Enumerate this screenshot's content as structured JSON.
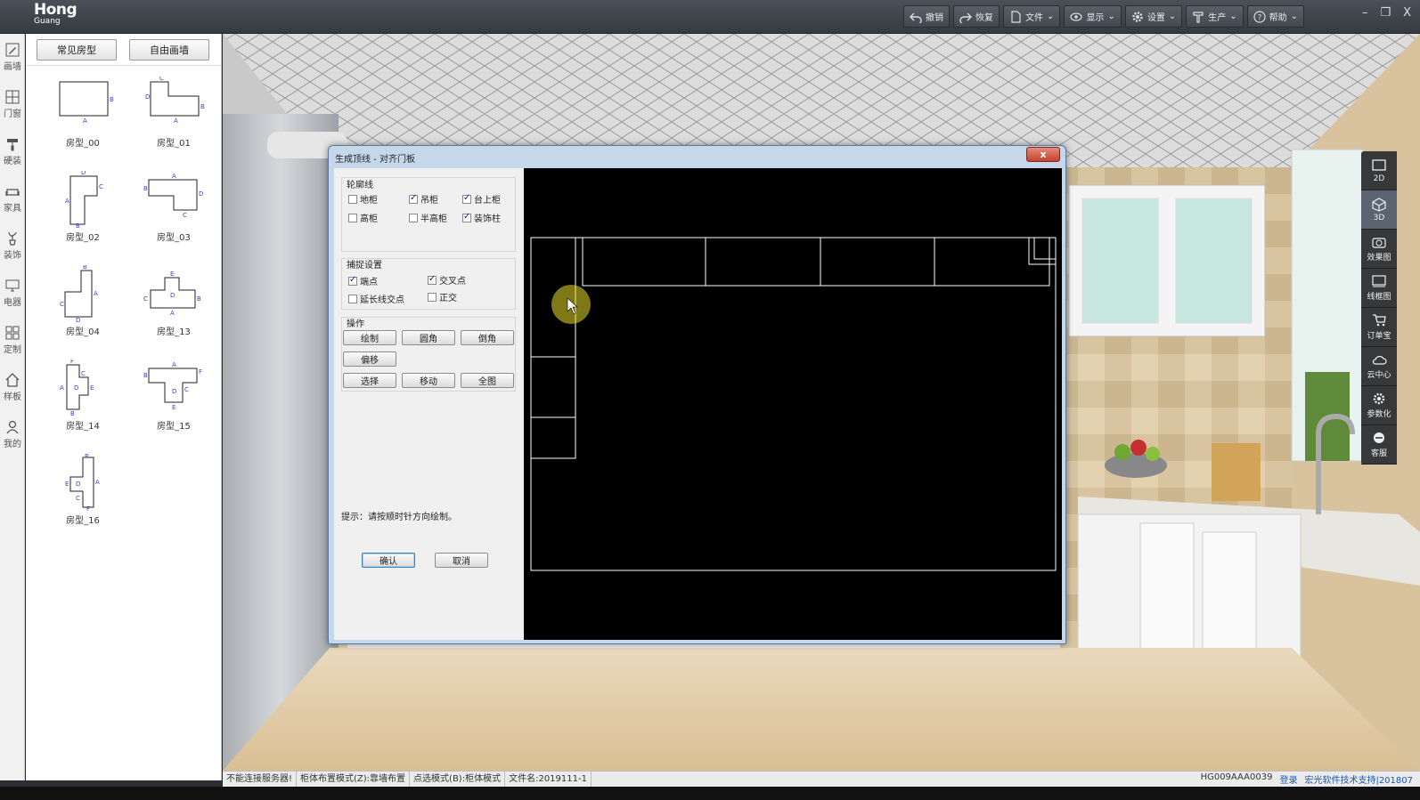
{
  "app": {
    "logo_main": "Hong",
    "logo_sub": "Guang"
  },
  "toolbar": [
    {
      "label": "撤销",
      "icon": "undo-icon"
    },
    {
      "label": "恢复",
      "icon": "redo-icon"
    },
    {
      "label": "文件",
      "icon": "file-icon"
    },
    {
      "label": "显示",
      "icon": "eye-icon"
    },
    {
      "label": "设置",
      "icon": "gear-icon"
    },
    {
      "label": "生产",
      "icon": "tool-icon"
    },
    {
      "label": "帮助",
      "icon": "help-icon"
    }
  ],
  "window_controls": {
    "minimize": "–",
    "restore": "❐",
    "close": "X"
  },
  "rail": [
    {
      "label": "画墙",
      "icon": "pencil-icon"
    },
    {
      "label": "门窗",
      "icon": "window-icon"
    },
    {
      "label": "硬装",
      "icon": "roller-icon"
    },
    {
      "label": "家具",
      "icon": "sofa-icon"
    },
    {
      "label": "装饰",
      "icon": "plant-icon"
    },
    {
      "label": "电器",
      "icon": "monitor-icon"
    },
    {
      "label": "定制",
      "icon": "grid-icon"
    },
    {
      "label": "样板",
      "icon": "home-icon"
    },
    {
      "label": "我的",
      "icon": "user-icon"
    }
  ],
  "room_panel": {
    "tabs": [
      "常见房型",
      "自由画墙"
    ],
    "rooms": [
      {
        "name": "房型_00",
        "letters": [
          "A",
          "B"
        ]
      },
      {
        "name": "房型_01",
        "letters": [
          "A",
          "B",
          "C",
          "D"
        ]
      },
      {
        "name": "房型_02",
        "letters": [
          "A",
          "B",
          "C",
          "D"
        ]
      },
      {
        "name": "房型_03",
        "letters": [
          "A",
          "B",
          "C",
          "D"
        ]
      },
      {
        "name": "房型_04",
        "letters": [
          "A",
          "B",
          "C",
          "D"
        ]
      },
      {
        "name": "房型_13",
        "letters": [
          "A",
          "B",
          "C",
          "D",
          "E"
        ]
      },
      {
        "name": "房型_14",
        "letters": [
          "A",
          "B",
          "C",
          "D",
          "E",
          "F"
        ]
      },
      {
        "name": "房型_15",
        "letters": [
          "A",
          "B",
          "C",
          "D",
          "E",
          "F"
        ]
      },
      {
        "name": "房型_16",
        "letters": [
          "A",
          "B",
          "C",
          "D",
          "E",
          "F"
        ]
      }
    ]
  },
  "right_tools": [
    {
      "label": "2D",
      "icon": "plan-2d-icon"
    },
    {
      "label": "3D",
      "icon": "cube-3d-icon"
    },
    {
      "label": "效果图",
      "icon": "camera-icon"
    },
    {
      "label": "线框图",
      "icon": "wireframe-icon"
    },
    {
      "label": "订单宝",
      "icon": "cart-icon"
    },
    {
      "label": "云中心",
      "icon": "cloud-icon"
    },
    {
      "label": "参数化",
      "icon": "params-gear-icon"
    },
    {
      "label": "客服",
      "icon": "headset-icon"
    }
  ],
  "dialog": {
    "title": "生成顶线 - 对齐门板",
    "close": "x",
    "outline_group": {
      "title": "轮廓线",
      "items": [
        {
          "label": "地柜",
          "checked": false
        },
        {
          "label": "吊柜",
          "checked": true
        },
        {
          "label": "台上柜",
          "checked": true
        },
        {
          "label": "高柜",
          "checked": false
        },
        {
          "label": "半高柜",
          "checked": false
        },
        {
          "label": "装饰柱",
          "checked": true
        }
      ]
    },
    "snap_group": {
      "title": "捕捉设置",
      "items": [
        {
          "label": "端点",
          "checked": true
        },
        {
          "label": "交叉点",
          "checked": true
        },
        {
          "label": "延长线交点",
          "checked": false
        },
        {
          "label": "正交",
          "checked": false
        }
      ]
    },
    "ops_group": {
      "title": "操作",
      "buttons": [
        "绘制",
        "圆角",
        "倒角",
        "偏移",
        "选择",
        "移动",
        "全图"
      ]
    },
    "hint": "提示：请按顺时针方向绘制。",
    "confirm": "确认",
    "cancel": "取消"
  },
  "statusbar": {
    "segments": [
      "不能连接服务器!",
      "柜体布置模式(Z):靠墙布置",
      "点选模式(B):柜体模式",
      "文件名:2019111-1"
    ],
    "code": "HG009AAA0039",
    "login": "登录",
    "support": "宏光软件技术支持|201807"
  }
}
